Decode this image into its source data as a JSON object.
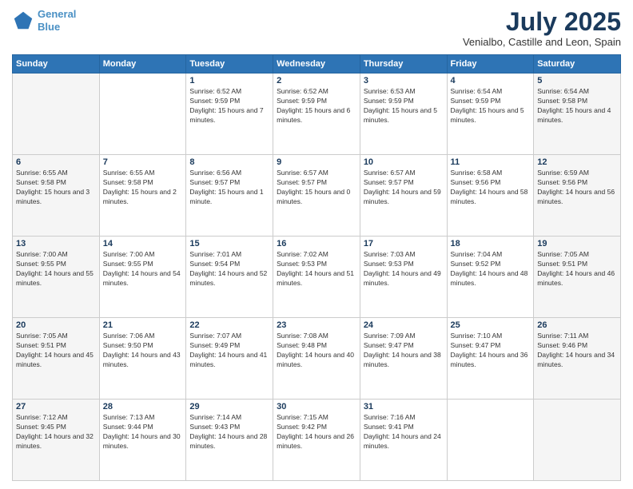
{
  "logo": {
    "line1": "General",
    "line2": "Blue"
  },
  "title": "July 2025",
  "subtitle": "Venialbo, Castille and Leon, Spain",
  "weekdays": [
    "Sunday",
    "Monday",
    "Tuesday",
    "Wednesday",
    "Thursday",
    "Friday",
    "Saturday"
  ],
  "weeks": [
    [
      {
        "day": "",
        "sunrise": "",
        "sunset": "",
        "daylight": ""
      },
      {
        "day": "",
        "sunrise": "",
        "sunset": "",
        "daylight": ""
      },
      {
        "day": "1",
        "sunrise": "Sunrise: 6:52 AM",
        "sunset": "Sunset: 9:59 PM",
        "daylight": "Daylight: 15 hours and 7 minutes."
      },
      {
        "day": "2",
        "sunrise": "Sunrise: 6:52 AM",
        "sunset": "Sunset: 9:59 PM",
        "daylight": "Daylight: 15 hours and 6 minutes."
      },
      {
        "day": "3",
        "sunrise": "Sunrise: 6:53 AM",
        "sunset": "Sunset: 9:59 PM",
        "daylight": "Daylight: 15 hours and 5 minutes."
      },
      {
        "day": "4",
        "sunrise": "Sunrise: 6:54 AM",
        "sunset": "Sunset: 9:59 PM",
        "daylight": "Daylight: 15 hours and 5 minutes."
      },
      {
        "day": "5",
        "sunrise": "Sunrise: 6:54 AM",
        "sunset": "Sunset: 9:58 PM",
        "daylight": "Daylight: 15 hours and 4 minutes."
      }
    ],
    [
      {
        "day": "6",
        "sunrise": "Sunrise: 6:55 AM",
        "sunset": "Sunset: 9:58 PM",
        "daylight": "Daylight: 15 hours and 3 minutes."
      },
      {
        "day": "7",
        "sunrise": "Sunrise: 6:55 AM",
        "sunset": "Sunset: 9:58 PM",
        "daylight": "Daylight: 15 hours and 2 minutes."
      },
      {
        "day": "8",
        "sunrise": "Sunrise: 6:56 AM",
        "sunset": "Sunset: 9:57 PM",
        "daylight": "Daylight: 15 hours and 1 minute."
      },
      {
        "day": "9",
        "sunrise": "Sunrise: 6:57 AM",
        "sunset": "Sunset: 9:57 PM",
        "daylight": "Daylight: 15 hours and 0 minutes."
      },
      {
        "day": "10",
        "sunrise": "Sunrise: 6:57 AM",
        "sunset": "Sunset: 9:57 PM",
        "daylight": "Daylight: 14 hours and 59 minutes."
      },
      {
        "day": "11",
        "sunrise": "Sunrise: 6:58 AM",
        "sunset": "Sunset: 9:56 PM",
        "daylight": "Daylight: 14 hours and 58 minutes."
      },
      {
        "day": "12",
        "sunrise": "Sunrise: 6:59 AM",
        "sunset": "Sunset: 9:56 PM",
        "daylight": "Daylight: 14 hours and 56 minutes."
      }
    ],
    [
      {
        "day": "13",
        "sunrise": "Sunrise: 7:00 AM",
        "sunset": "Sunset: 9:55 PM",
        "daylight": "Daylight: 14 hours and 55 minutes."
      },
      {
        "day": "14",
        "sunrise": "Sunrise: 7:00 AM",
        "sunset": "Sunset: 9:55 PM",
        "daylight": "Daylight: 14 hours and 54 minutes."
      },
      {
        "day": "15",
        "sunrise": "Sunrise: 7:01 AM",
        "sunset": "Sunset: 9:54 PM",
        "daylight": "Daylight: 14 hours and 52 minutes."
      },
      {
        "day": "16",
        "sunrise": "Sunrise: 7:02 AM",
        "sunset": "Sunset: 9:53 PM",
        "daylight": "Daylight: 14 hours and 51 minutes."
      },
      {
        "day": "17",
        "sunrise": "Sunrise: 7:03 AM",
        "sunset": "Sunset: 9:53 PM",
        "daylight": "Daylight: 14 hours and 49 minutes."
      },
      {
        "day": "18",
        "sunrise": "Sunrise: 7:04 AM",
        "sunset": "Sunset: 9:52 PM",
        "daylight": "Daylight: 14 hours and 48 minutes."
      },
      {
        "day": "19",
        "sunrise": "Sunrise: 7:05 AM",
        "sunset": "Sunset: 9:51 PM",
        "daylight": "Daylight: 14 hours and 46 minutes."
      }
    ],
    [
      {
        "day": "20",
        "sunrise": "Sunrise: 7:05 AM",
        "sunset": "Sunset: 9:51 PM",
        "daylight": "Daylight: 14 hours and 45 minutes."
      },
      {
        "day": "21",
        "sunrise": "Sunrise: 7:06 AM",
        "sunset": "Sunset: 9:50 PM",
        "daylight": "Daylight: 14 hours and 43 minutes."
      },
      {
        "day": "22",
        "sunrise": "Sunrise: 7:07 AM",
        "sunset": "Sunset: 9:49 PM",
        "daylight": "Daylight: 14 hours and 41 minutes."
      },
      {
        "day": "23",
        "sunrise": "Sunrise: 7:08 AM",
        "sunset": "Sunset: 9:48 PM",
        "daylight": "Daylight: 14 hours and 40 minutes."
      },
      {
        "day": "24",
        "sunrise": "Sunrise: 7:09 AM",
        "sunset": "Sunset: 9:47 PM",
        "daylight": "Daylight: 14 hours and 38 minutes."
      },
      {
        "day": "25",
        "sunrise": "Sunrise: 7:10 AM",
        "sunset": "Sunset: 9:47 PM",
        "daylight": "Daylight: 14 hours and 36 minutes."
      },
      {
        "day": "26",
        "sunrise": "Sunrise: 7:11 AM",
        "sunset": "Sunset: 9:46 PM",
        "daylight": "Daylight: 14 hours and 34 minutes."
      }
    ],
    [
      {
        "day": "27",
        "sunrise": "Sunrise: 7:12 AM",
        "sunset": "Sunset: 9:45 PM",
        "daylight": "Daylight: 14 hours and 32 minutes."
      },
      {
        "day": "28",
        "sunrise": "Sunrise: 7:13 AM",
        "sunset": "Sunset: 9:44 PM",
        "daylight": "Daylight: 14 hours and 30 minutes."
      },
      {
        "day": "29",
        "sunrise": "Sunrise: 7:14 AM",
        "sunset": "Sunset: 9:43 PM",
        "daylight": "Daylight: 14 hours and 28 minutes."
      },
      {
        "day": "30",
        "sunrise": "Sunrise: 7:15 AM",
        "sunset": "Sunset: 9:42 PM",
        "daylight": "Daylight: 14 hours and 26 minutes."
      },
      {
        "day": "31",
        "sunrise": "Sunrise: 7:16 AM",
        "sunset": "Sunset: 9:41 PM",
        "daylight": "Daylight: 14 hours and 24 minutes."
      },
      {
        "day": "",
        "sunrise": "",
        "sunset": "",
        "daylight": ""
      },
      {
        "day": "",
        "sunrise": "",
        "sunset": "",
        "daylight": ""
      }
    ]
  ]
}
